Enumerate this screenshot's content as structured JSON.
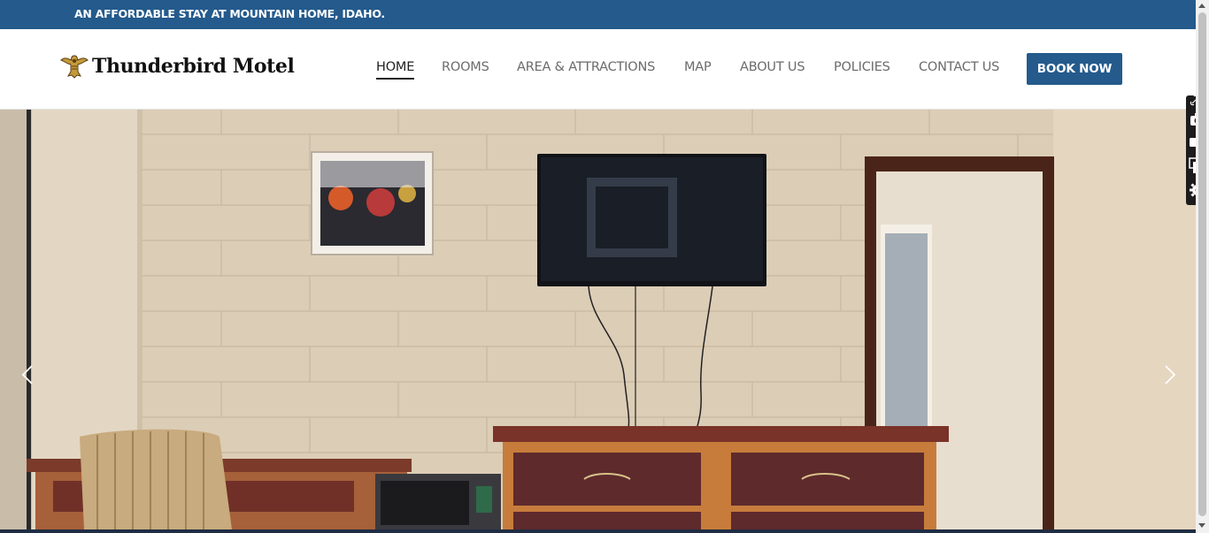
{
  "topbar": {
    "tagline": "AN AFFORDABLE STAY AT MOUNTAIN HOME, IDAHO."
  },
  "header": {
    "logo_text": "Thunderbird Motel",
    "logo_icon": "thunderbird-emblem",
    "nav": [
      {
        "label": "HOME",
        "active": true
      },
      {
        "label": "ROOMS",
        "active": false
      },
      {
        "label": "AREA & ATTRACTIONS",
        "active": false
      },
      {
        "label": "MAP",
        "active": false
      },
      {
        "label": "ABOUT US",
        "active": false
      },
      {
        "label": "POLICIES",
        "active": false
      },
      {
        "label": "CONTACT US",
        "active": false
      }
    ],
    "book_button": "BOOK NOW"
  },
  "hero": {
    "image_icon": "motel-room-photo",
    "prev_icon": "chevron-left-icon",
    "next_icon": "chevron-right-icon"
  },
  "side_tools": {
    "icons": [
      "link-icon",
      "camera-icon",
      "video-icon",
      "window-icon",
      "gear-icon"
    ]
  },
  "colors": {
    "brand_blue": "#245a8c",
    "text_dark": "#222222",
    "nav_text": "#6b6b6b"
  }
}
